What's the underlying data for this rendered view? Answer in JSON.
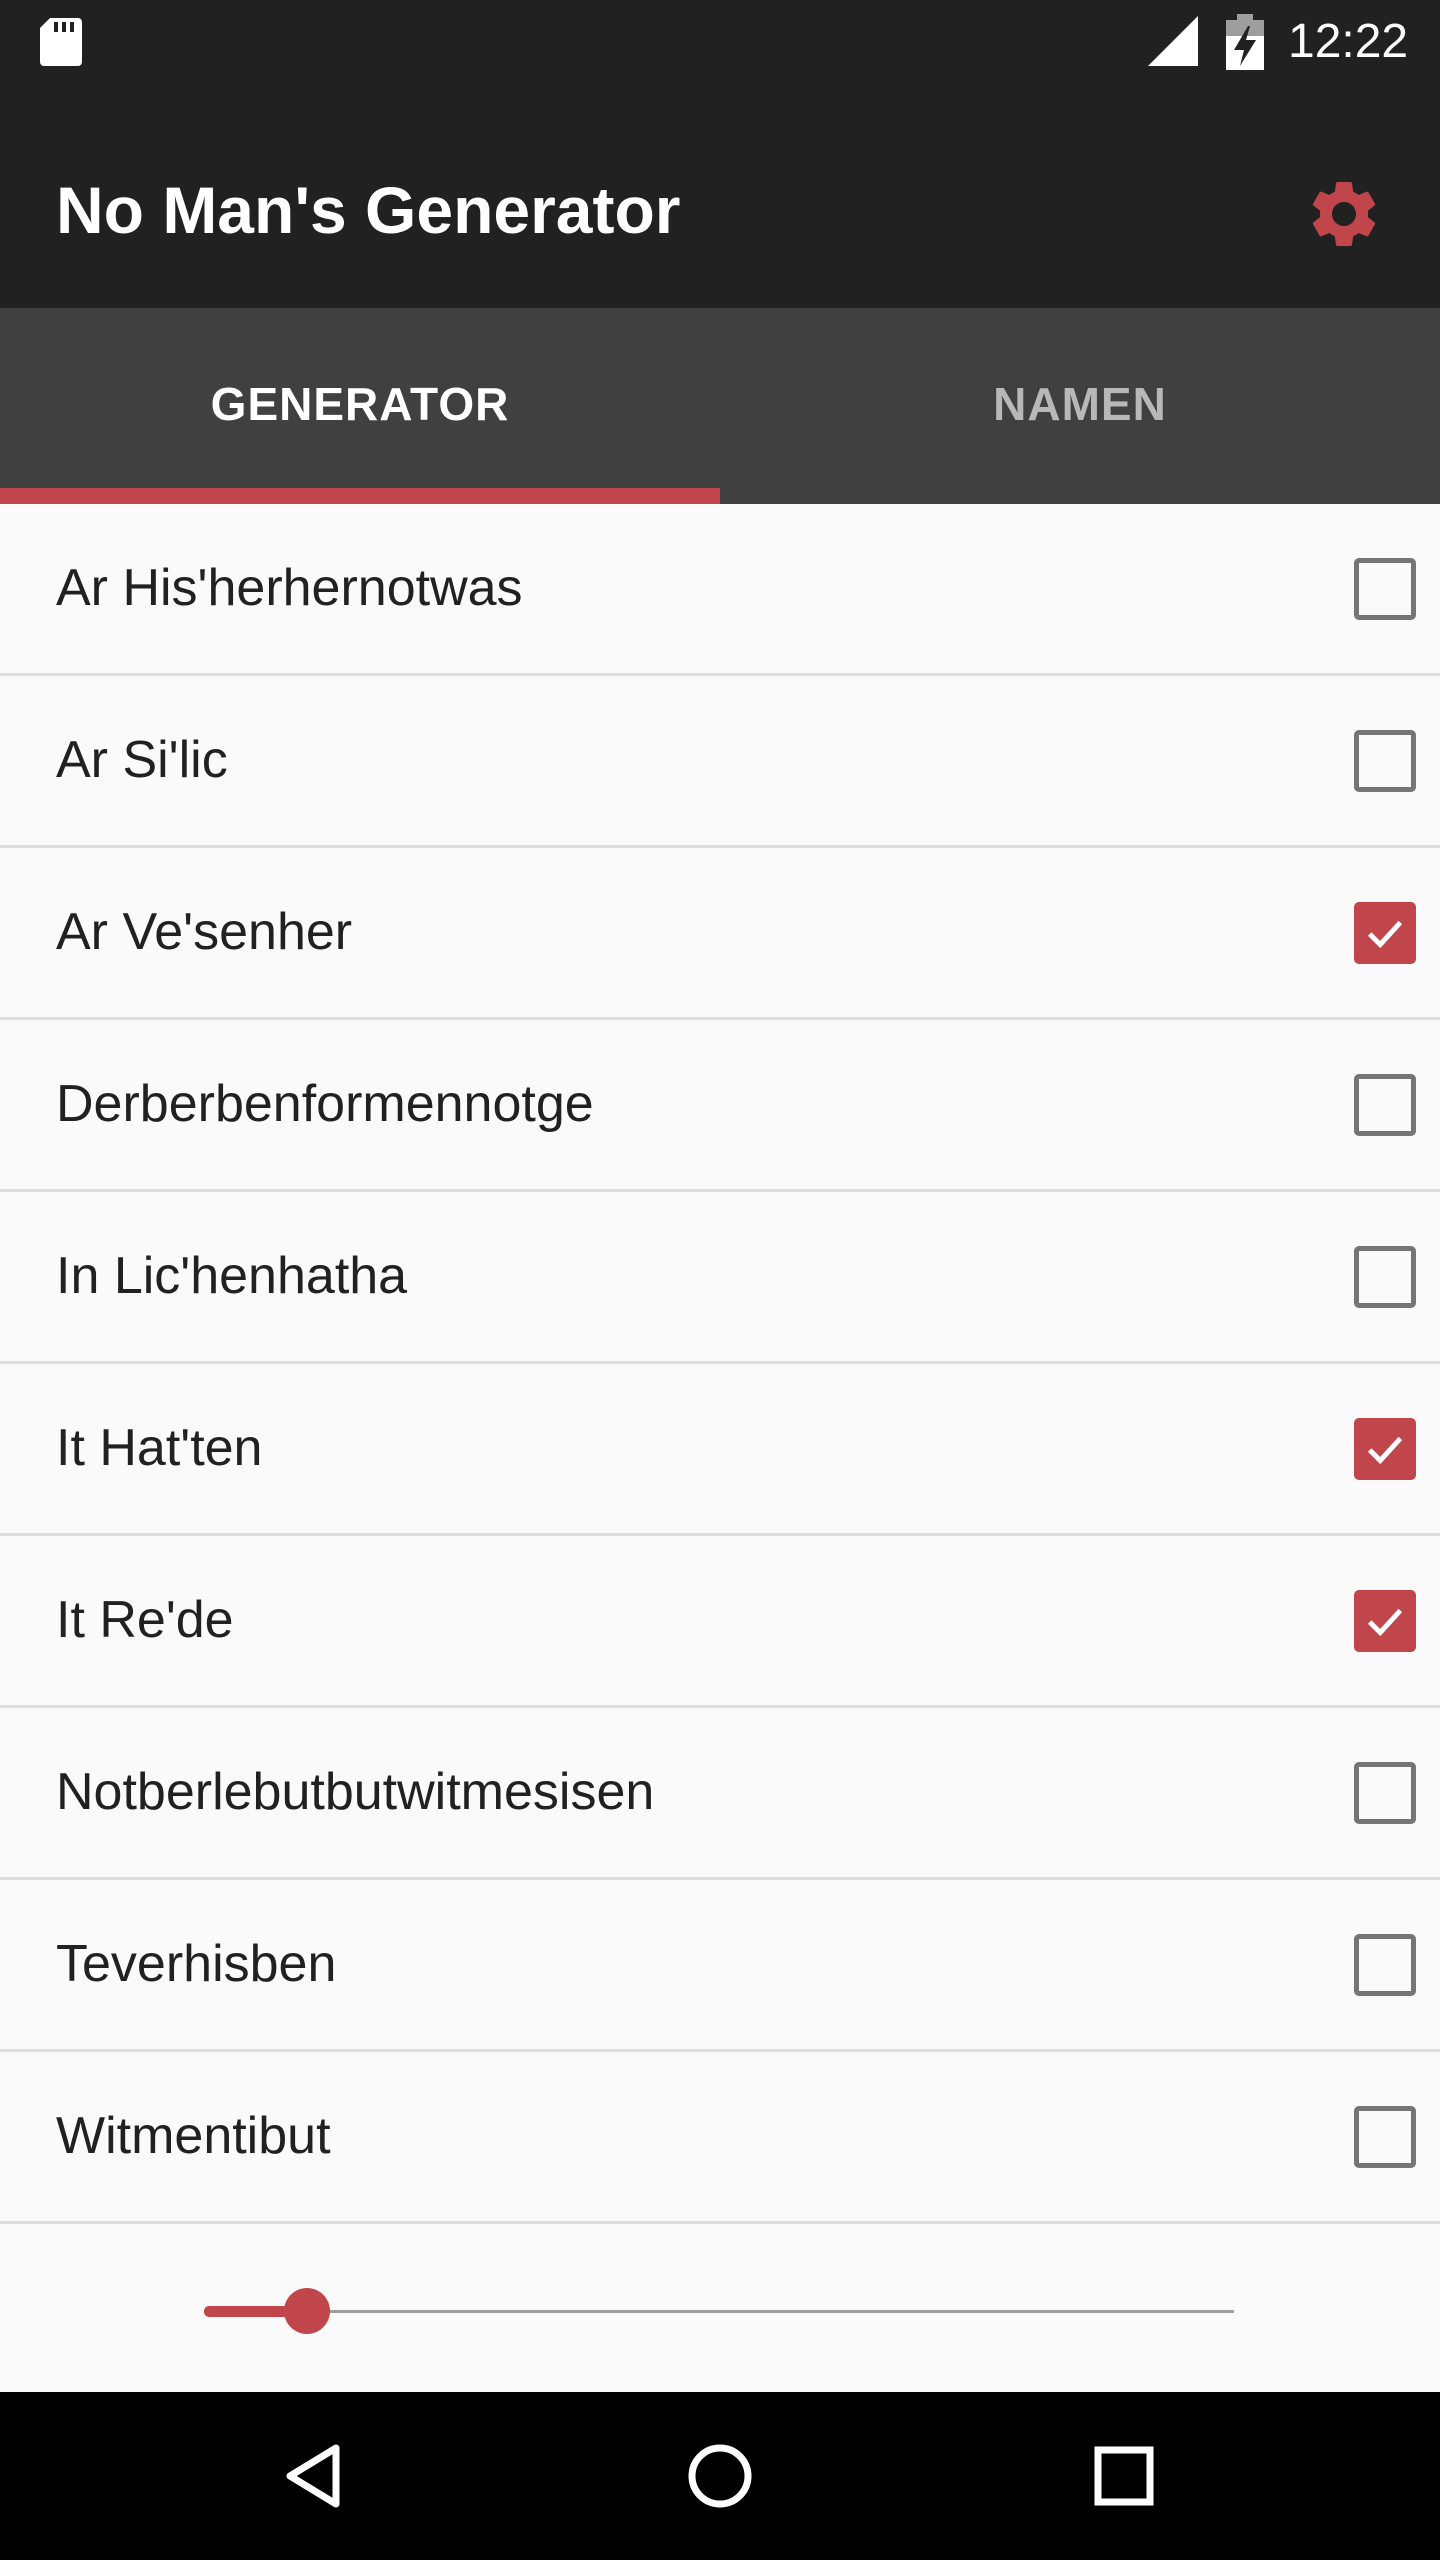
{
  "status_bar": {
    "time": "12:22",
    "icons": [
      "sd-card-icon",
      "signal-icon",
      "battery-charging-icon"
    ]
  },
  "app_bar": {
    "title": "No Man's Generator",
    "settings_icon": "gear-icon"
  },
  "tabs": [
    {
      "label": "GENERATOR",
      "selected": true
    },
    {
      "label": "NAMEN",
      "selected": false
    }
  ],
  "list": [
    {
      "label": "Ar His'herhernotwas",
      "checked": false
    },
    {
      "label": "Ar Si'lic",
      "checked": false
    },
    {
      "label": "Ar Ve'senher",
      "checked": true
    },
    {
      "label": "Derberbenformennotge",
      "checked": false
    },
    {
      "label": "In Lic'henhatha",
      "checked": false
    },
    {
      "label": "It Hat'ten",
      "checked": true
    },
    {
      "label": "It Re'de",
      "checked": true
    },
    {
      "label": "Notberlebutbutwitmesisen",
      "checked": false
    },
    {
      "label": "Teverhisben",
      "checked": false
    },
    {
      "label": "Witmentibut",
      "checked": false
    }
  ],
  "slider": {
    "value_fraction": 0.1
  },
  "nav_bar": {
    "icons": [
      "back-icon",
      "home-icon",
      "recents-icon"
    ]
  },
  "colors": {
    "accent": "#c1464b",
    "app_bar": "#212121",
    "tab_bar": "#404040",
    "background": "#fafafa"
  }
}
